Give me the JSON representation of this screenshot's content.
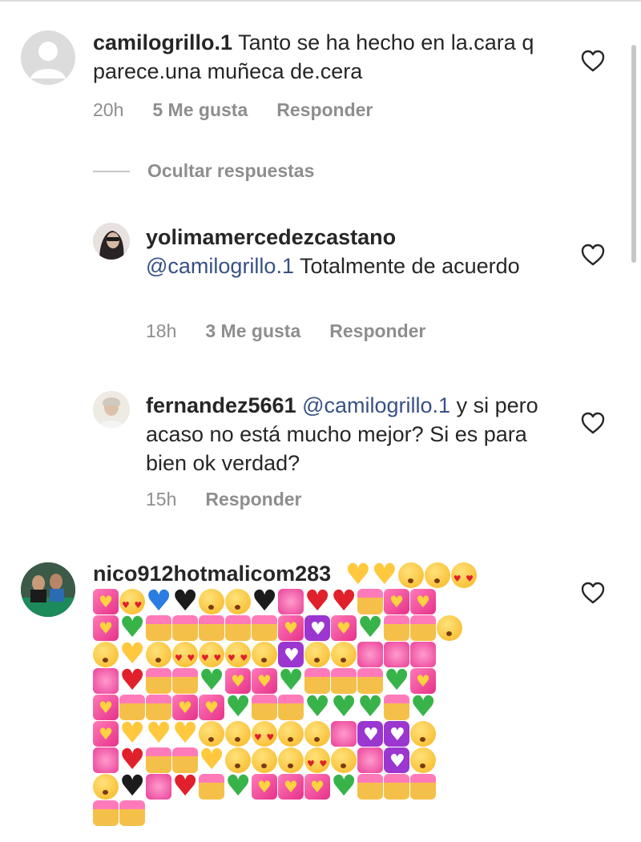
{
  "comments": [
    {
      "username": "camilogrillo.1",
      "text": " Tanto se ha hecho en la.cara q parece.una muñeca de.cera",
      "time": "20h",
      "likes": "5 Me gusta",
      "reply": "Responder"
    },
    {
      "username": "yolimamercedezcastano",
      "mention": "@camilogrillo.1",
      "text": " Totalmente de acuerdo",
      "time": "18h",
      "likes": "3 Me gusta",
      "reply": "Responder"
    },
    {
      "username": "fernandez5661",
      "mention": " @camilogrillo.1",
      "text": " y si pero acaso no está mucho mejor? Si es para bien ok verdad?",
      "time": "15h",
      "reply": "Responder"
    },
    {
      "username": "nico912hotmalicom283"
    }
  ],
  "hide_replies": "Ocultar respuestas",
  "icons": {
    "like": "heart-outline-icon"
  },
  "emoji_rows": [
    [
      "yellow-heart",
      "yellow-heart",
      "face",
      "face",
      "face-heart"
    ],
    [
      "gift",
      "face-heart",
      "heart-blue",
      "heart-black",
      "face",
      "face",
      "heart-black",
      "sparkle",
      "heart-red",
      "heart-red",
      "hands",
      "gift",
      "gift"
    ],
    [
      "gift",
      "heart-green",
      "hands",
      "hands",
      "hands",
      "hands",
      "hands",
      "gift",
      "box",
      "gift",
      "heart-green",
      "hands",
      "hands",
      "face"
    ],
    [
      "face",
      "yellow-heart",
      "face",
      "face-heart",
      "face-heart",
      "face-heart",
      "face",
      "box",
      "face",
      "face",
      "sparkle",
      "sparkle",
      "sparkle"
    ],
    [
      "sparkle",
      "heart-red",
      "hands",
      "hands",
      "heart-green",
      "gift",
      "gift",
      "heart-green",
      "hands",
      "hands",
      "hands",
      "heart-green",
      "gift"
    ],
    [
      "gift",
      "hands",
      "hands",
      "gift",
      "gift",
      "heart-green",
      "hands",
      "hands",
      "heart-green",
      "heart-green",
      "heart-green",
      "hands",
      "heart-green"
    ],
    [
      "gift",
      "yellow-heart",
      "yellow-heart",
      "yellow-heart",
      "face",
      "face",
      "face-heart",
      "face",
      "face",
      "sparkle",
      "box",
      "box",
      "face"
    ],
    [
      "sparkle",
      "heart-red",
      "hands",
      "hands",
      "yellow-heart",
      "face",
      "face",
      "face",
      "face-heart",
      "face",
      "sparkle",
      "box",
      "face"
    ],
    [
      "face",
      "heart-black",
      "sparkle",
      "heart-red",
      "hands",
      "heart-green",
      "gift",
      "gift",
      "gift",
      "heart-green",
      "hands",
      "hands",
      "hands"
    ],
    [
      "hands",
      "hands"
    ]
  ]
}
